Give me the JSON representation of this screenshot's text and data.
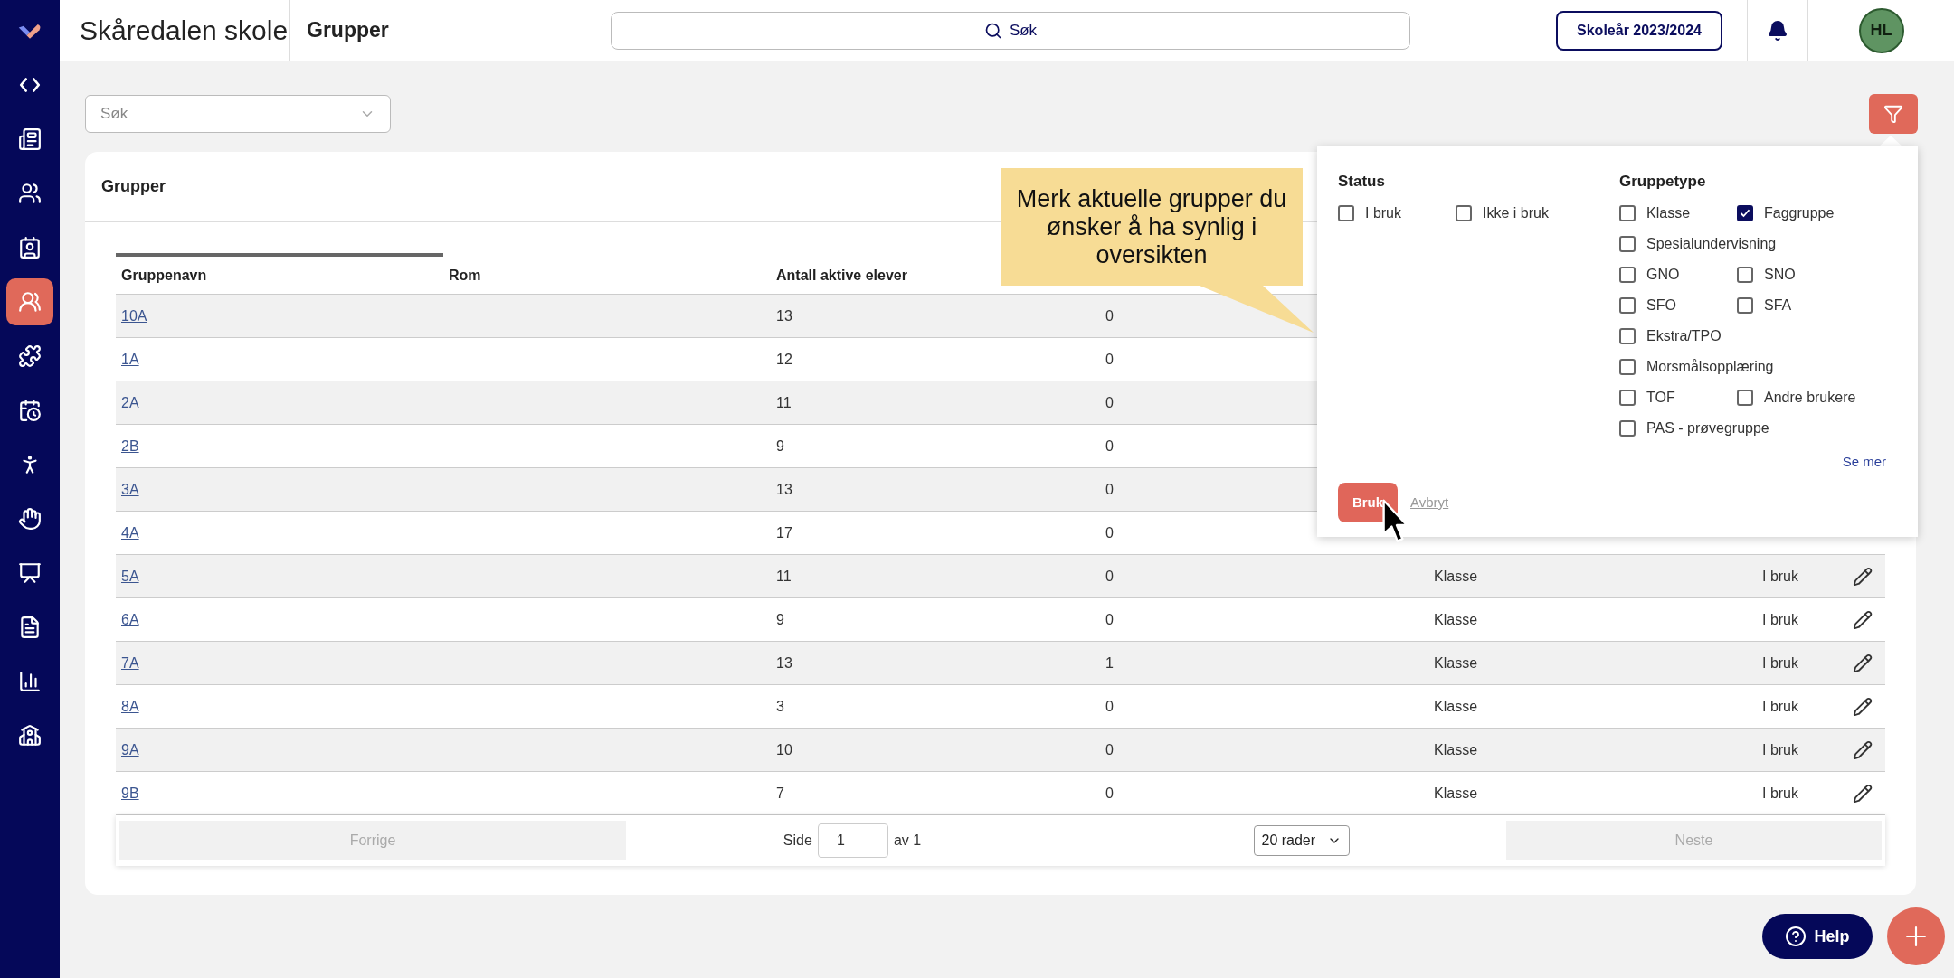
{
  "sidebar": {
    "items": [
      {
        "selected": false
      },
      {
        "selected": false
      },
      {
        "selected": false
      },
      {
        "selected": false
      },
      {
        "selected": true
      },
      {
        "selected": false
      },
      {
        "selected": false
      },
      {
        "selected": false
      },
      {
        "selected": false
      },
      {
        "selected": false
      },
      {
        "selected": false
      },
      {
        "selected": false
      },
      {
        "selected": false
      }
    ]
  },
  "header": {
    "school": "Skåredalen skole",
    "page": "Grupper",
    "search": "Søk",
    "school_year": "Skoleår 2023/2024",
    "avatar": "HL"
  },
  "filter_select": {
    "placeholder": "Søk"
  },
  "card": {
    "title": "Grupper"
  },
  "table": {
    "columns": [
      "Gruppenavn",
      "Rom",
      "Antall aktive elever"
    ],
    "rows": [
      {
        "name": "10A",
        "students": "13",
        "column_4": "0"
      },
      {
        "name": "1A",
        "students": "12",
        "column_4": "0"
      },
      {
        "name": "2A",
        "students": "11",
        "column_4": "0"
      },
      {
        "name": "2B",
        "students": "9",
        "column_4": "0"
      },
      {
        "name": "3A",
        "students": "13",
        "column_4": "0"
      },
      {
        "name": "4A",
        "students": "17",
        "column_4": "0"
      },
      {
        "name": "5A",
        "students": "11",
        "column_4": "0",
        "type": "Klasse",
        "status": "I bruk"
      },
      {
        "name": "6A",
        "students": "9",
        "column_4": "0",
        "type": "Klasse",
        "status": "I bruk"
      },
      {
        "name": "7A",
        "students": "13",
        "column_4": "1",
        "type": "Klasse",
        "status": "I bruk"
      },
      {
        "name": "8A",
        "students": "3",
        "column_4": "0",
        "type": "Klasse",
        "status": "I bruk"
      },
      {
        "name": "9A",
        "students": "10",
        "column_4": "0",
        "type": "Klasse",
        "status": "I bruk"
      },
      {
        "name": "9B",
        "students": "7",
        "column_4": "0",
        "type": "Klasse",
        "status": "I bruk"
      }
    ]
  },
  "pagination": {
    "previous": "Forrige",
    "previous_disabled": true,
    "page_label": "Side",
    "page": "1",
    "of": "av 1",
    "rows": "20 rader",
    "next": "Neste",
    "next_disabled": true
  },
  "tooltip": {
    "text": "Merk aktuelle grupper du ønsker å ha synlig i oversikten"
  },
  "filter_panel": {
    "status": {
      "title": "Status",
      "rows": [
        [
          {
            "label": "I bruk",
            "checked": false
          },
          {
            "label": "Ikke i bruk",
            "checked": false
          }
        ]
      ]
    },
    "group_type": {
      "title": "Gruppetype",
      "rows": [
        [
          {
            "label": "Klasse",
            "checked": false
          },
          {
            "label": "Faggruppe",
            "checked": true
          }
        ],
        [
          {
            "label": "Spesialundervisning",
            "checked": false
          }
        ],
        [
          {
            "label": "GNO",
            "checked": false
          },
          {
            "label": "SNO",
            "checked": false
          }
        ],
        [
          {
            "label": "SFO",
            "checked": false
          },
          {
            "label": "SFA",
            "checked": false
          }
        ],
        [
          {
            "label": "Ekstra/TPO",
            "checked": false
          }
        ],
        [
          {
            "label": "Morsmålsopplæring",
            "checked": false
          }
        ],
        [
          {
            "label": "TOF",
            "checked": false
          },
          {
            "label": "Andre brukere",
            "checked": false
          }
        ],
        [
          {
            "label": "PAS - prøvegruppe",
            "checked": false
          }
        ]
      ]
    },
    "see_more": "Se mer",
    "apply": "Bruk",
    "cancel": "Avbryt"
  },
  "help": "Help"
}
